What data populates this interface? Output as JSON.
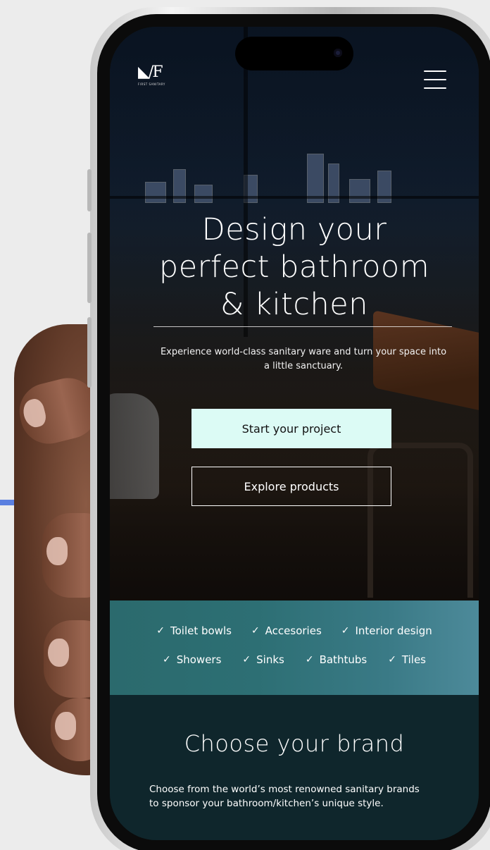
{
  "logo": {
    "mark": "◣/F",
    "text": "FIRST SANITARY"
  },
  "hero": {
    "headline": "Design your perfect bathroom & kitchen",
    "subtitle": "Experience world-class sanitary ware and turn your space into a little sanctuary.",
    "primary_cta": "Start your project",
    "secondary_cta": "Explore products"
  },
  "categories": {
    "row1": [
      "Toilet bowls",
      "Accesories",
      "Interior design"
    ],
    "row2": [
      "Showers",
      "Sinks",
      "Bathtubs",
      "Tiles"
    ],
    "check_icon": "✓"
  },
  "brand_section": {
    "title": "Choose your brand",
    "description": "Choose from the world’s most renowned sanitary brands to sponsor your bathroom/kitchen’s unique style."
  },
  "icons": {
    "menu": "hamburger-icon",
    "check": "check-icon"
  },
  "colors": {
    "cta_bg": "#dcfbf5",
    "category_band": "#2d6f74",
    "brand_bg": "#0f262c",
    "accent": "#5a7fe0"
  }
}
